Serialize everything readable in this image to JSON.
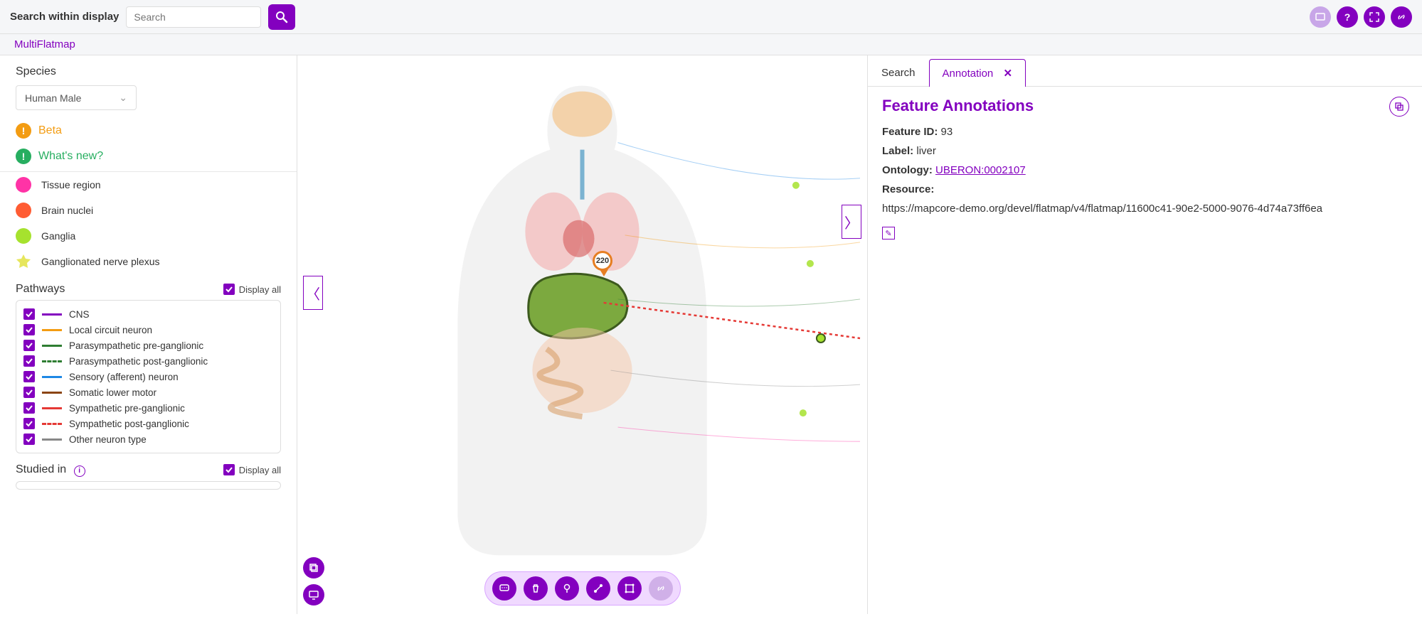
{
  "topbar": {
    "search_label": "Search within display",
    "search_placeholder": "Search"
  },
  "subtitle": "MultiFlatmap",
  "species": {
    "label": "Species",
    "selected": "Human Male"
  },
  "beta_label": "Beta",
  "whatsnew_label": "What's new?",
  "legend": [
    {
      "label": "Tissue region",
      "color": "#ff33a6",
      "shape": "circle"
    },
    {
      "label": "Brain nuclei",
      "color": "#ff5c33",
      "shape": "circle"
    },
    {
      "label": "Ganglia",
      "color": "#a6e22e",
      "shape": "circle"
    },
    {
      "label": "Ganglionated nerve plexus",
      "color": "#e6e65c",
      "shape": "star"
    }
  ],
  "pathways": {
    "title": "Pathways",
    "display_all_label": "Display all",
    "items": [
      {
        "label": "CNS",
        "color": "#8300BF",
        "dashed": false
      },
      {
        "label": "Local circuit neuron",
        "color": "#f39c12",
        "dashed": false
      },
      {
        "label": "Parasympathetic pre-ganglionic",
        "color": "#2e7d32",
        "dashed": false
      },
      {
        "label": "Parasympathetic post-ganglionic",
        "color": "#2e7d32",
        "dashed": true
      },
      {
        "label": "Sensory (afferent) neuron",
        "color": "#1e88e5",
        "dashed": false
      },
      {
        "label": "Somatic lower motor",
        "color": "#8b4513",
        "dashed": false
      },
      {
        "label": "Sympathetic pre-ganglionic",
        "color": "#e53935",
        "dashed": false
      },
      {
        "label": "Sympathetic post-ganglionic",
        "color": "#e53935",
        "dashed": true
      },
      {
        "label": "Other neuron type",
        "color": "#888",
        "dashed": false
      }
    ]
  },
  "studied_in": {
    "title": "Studied in",
    "display_all_label": "Display all"
  },
  "marker_value": "220",
  "right_panel": {
    "tabs": [
      {
        "label": "Search",
        "active": false
      },
      {
        "label": "Annotation",
        "active": true
      }
    ],
    "title": "Feature Annotations",
    "feature_id_key": "Feature ID:",
    "feature_id_val": "93",
    "label_key": "Label:",
    "label_val": "liver",
    "ontology_key": "Ontology:",
    "ontology_val": "UBERON:0002107",
    "resource_key": "Resource:",
    "resource_val": "https://mapcore-demo.org/devel/flatmap/v4/flatmap/11600c41-90e2-5000-9076-4d74a73ff6ea"
  }
}
